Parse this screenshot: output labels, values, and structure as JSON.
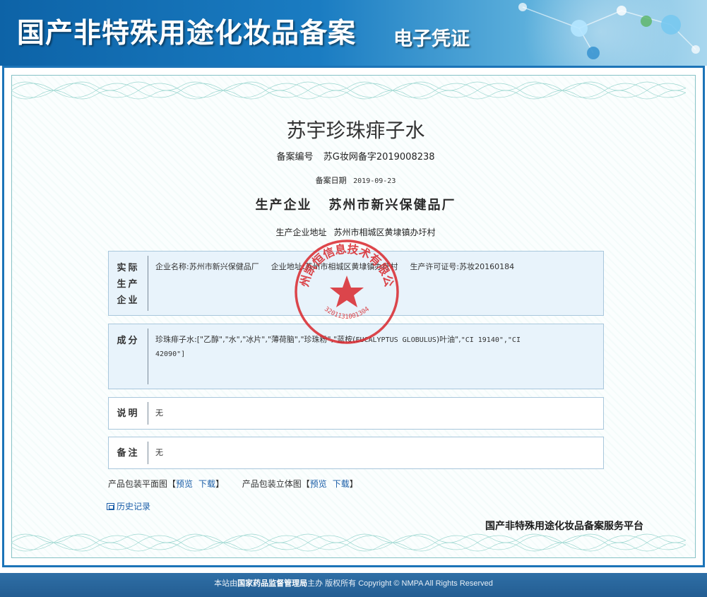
{
  "header": {
    "title": "国产非特殊用途化妆品备案",
    "subtitle": "电子凭证"
  },
  "record": {
    "product_name": "苏宇珍珠痱子水",
    "registration_label": "备案编号",
    "registration_number": "苏G妆网备字2019008238",
    "date_label": "备案日期",
    "date": "2019-09-23",
    "enterprise_label": "生产企业",
    "enterprise_name": "苏州市新兴保健品厂",
    "address_label": "生产企业地址",
    "address": "苏州市相城区黄埭镇办圩村"
  },
  "sections": {
    "actual_enterprise": {
      "label_lines": [
        "实际",
        "生产",
        "企业"
      ],
      "name_label": "企业名称:",
      "name": "苏州市新兴保健品厂",
      "address_label": "企业地址:",
      "address": "苏州市相城区黄埭镇办圩村",
      "license_label": "生产许可证号:",
      "license": "苏妆20160184"
    },
    "ingredients": {
      "label": "成分",
      "text_prefix": "珍珠痱子水:[\"乙醇\",\"水\",\"冰片\",\"薄荷脑\",\"珍珠粉\",\"蓝桉(",
      "text_latin": "EUCALYPTUS GLOBULUS",
      "text_mid": ")叶油\",",
      "text_ci1": "\"CI 19140\",\"CI",
      "text_ci2": "42090\"]"
    },
    "description": {
      "label": "说明",
      "value": "无"
    },
    "remarks": {
      "label": "备注",
      "value": "无"
    }
  },
  "links": {
    "flat_label": "产品包装平面图",
    "stereo_label": "产品包装立体图",
    "preview": "预览",
    "download": "下载",
    "bracket_open": "【",
    "bracket_close": "】",
    "history": "历史记录"
  },
  "platform_name": "国产非特殊用途化妆品备案服务平台",
  "seal": {
    "text": "苏州凯恒信息技术有限公司",
    "number": "3201131001304"
  },
  "footer": {
    "prefix": "本站由",
    "org": "国家药品监督管理局",
    "suffix": "主办 版权所有 Copyright © NMPA All Rights Reserved"
  },
  "colors": {
    "banner_blue": "#0d63a7",
    "frame_blue": "#1c74b8",
    "box_blue": "#e8f3fb",
    "seal_red": "#d8262b",
    "link_blue": "#1b5ea8",
    "footer_blue": "#2f6fa6"
  }
}
